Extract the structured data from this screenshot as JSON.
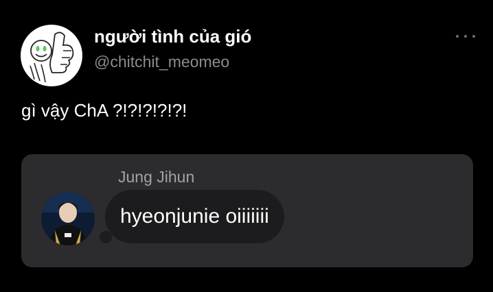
{
  "author": {
    "display_name": "người tình của gió",
    "handle": "@chitchit_meomeo"
  },
  "tweet": {
    "text": "gì vậy ChA ?!?!?!?!?!"
  },
  "message_card": {
    "sender_name": "Jung Jihun",
    "message_text": "hyeonjunie oiiiiiii"
  },
  "colors": {
    "background": "#000000",
    "card_background": "#2c2c2e",
    "bubble_background": "#1c1c1e",
    "secondary_text": "#8b8b90"
  },
  "icons": [
    "more-options-icon",
    "profile-avatar",
    "sender-avatar"
  ]
}
